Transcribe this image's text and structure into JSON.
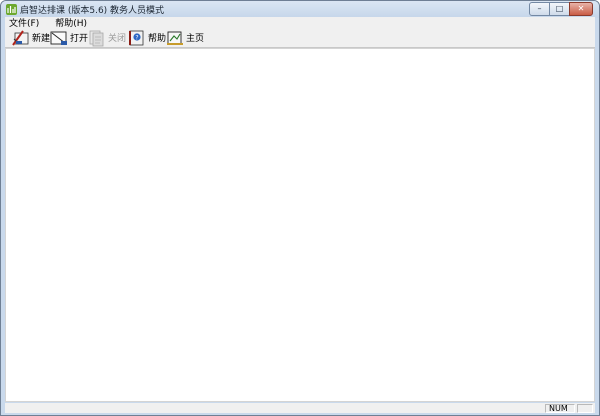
{
  "window": {
    "title": "启智达排课 (版本5.6)  教务人员模式"
  },
  "title_controls": {
    "minimize_glyph": "–",
    "maximize_glyph": "□",
    "close_glyph": "✕"
  },
  "menu": [
    {
      "label": "文件(F)"
    },
    {
      "label": "帮助(H)"
    }
  ],
  "toolbar": {
    "new_label": "新建",
    "open_label": "打开",
    "close_label": "关闭",
    "help_label": "帮助",
    "home_label": "主页"
  },
  "statusbar": {
    "num_indicator": "NUM"
  },
  "colors": {
    "app_icon": "#6ca82f",
    "frame": "#c9d9ec",
    "client": "#ffffff"
  }
}
